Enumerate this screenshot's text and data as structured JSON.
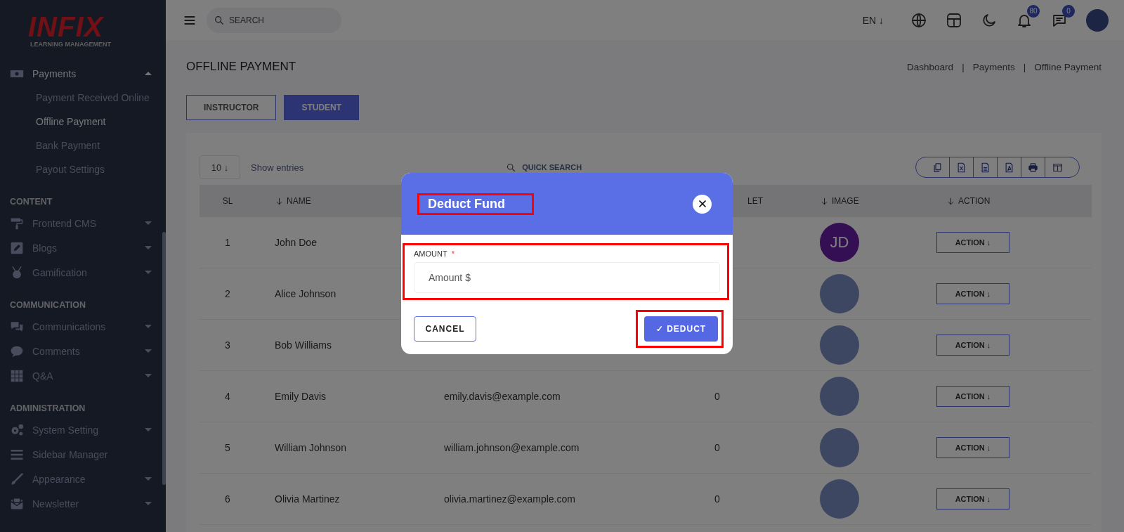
{
  "sidebar": {
    "logo": {
      "mark": "INFIX",
      "tagline": "LEARNING MANAGEMENT"
    },
    "sections": [
      {
        "items": [
          {
            "label": "Payments",
            "expandable": true,
            "expanded": true,
            "children": [
              {
                "label": "Payment Received Online",
                "selected": false
              },
              {
                "label": "Offline Payment",
                "selected": true
              },
              {
                "label": "Bank Payment",
                "selected": false
              },
              {
                "label": "Payout Settings",
                "selected": false
              }
            ]
          }
        ]
      },
      {
        "heading": "CONTENT",
        "items": [
          {
            "label": "Frontend CMS",
            "expandable": true,
            "expanded": false
          },
          {
            "label": "Blogs",
            "expandable": true,
            "expanded": false
          },
          {
            "label": "Gamification",
            "expandable": true,
            "expanded": false
          }
        ]
      },
      {
        "heading": "COMMUNICATION",
        "items": [
          {
            "label": "Communications",
            "expandable": true,
            "expanded": false
          },
          {
            "label": "Comments",
            "expandable": true,
            "expanded": false
          },
          {
            "label": "Q&A",
            "expandable": true,
            "expanded": false
          }
        ]
      },
      {
        "heading": "ADMINISTRATION",
        "items": [
          {
            "label": "System Setting",
            "expandable": true,
            "expanded": false
          },
          {
            "label": "Sidebar Manager",
            "expandable": false,
            "expanded": false
          },
          {
            "label": "Appearance",
            "expandable": true,
            "expanded": false
          },
          {
            "label": "Newsletter",
            "expandable": true,
            "expanded": false
          }
        ]
      }
    ]
  },
  "topbar": {
    "search": {
      "placeholder": "SEARCH"
    },
    "language": "EN ↓",
    "notifications": "80",
    "messages": "0"
  },
  "page": {
    "title": "OFFLINE PAYMENT",
    "breadcrumb": [
      "Dashboard",
      "Payments",
      "Offline Payment"
    ],
    "breadcrumb_separator": "|",
    "tabs": [
      {
        "label": "INSTRUCTOR",
        "selected": false
      },
      {
        "label": "STUDENT",
        "selected": true
      }
    ]
  },
  "table": {
    "page_size": "10 ↓",
    "show_entries": "Show entries",
    "quick_search": "QUICK SEARCH",
    "columns": [
      {
        "label": "SL",
        "sortable": false
      },
      {
        "label": "NAME",
        "sortable": true
      },
      {
        "label": "LET",
        "sortable": false
      },
      {
        "label": "IMAGE",
        "sortable": true
      },
      {
        "label": "ACTION",
        "sortable": true
      }
    ],
    "rows": [
      {
        "sl": "1",
        "name": "John Doe",
        "avatar": {
          "kind": "initials",
          "initials": "JD"
        },
        "action": "ACTION ↓"
      },
      {
        "sl": "2",
        "name": "Alice Johnson",
        "avatar": {
          "kind": "photo"
        },
        "action": "ACTION ↓"
      },
      {
        "sl": "3",
        "name": "Bob Williams",
        "avatar": {
          "kind": "photo"
        },
        "action": "ACTION ↓"
      },
      {
        "sl": "4",
        "name": "Emily Davis",
        "email": "emily.davis@example.com",
        "wallet": "0",
        "avatar": {
          "kind": "photo"
        },
        "action": "ACTION ↓"
      },
      {
        "sl": "5",
        "name": "William Johnson",
        "email": "william.johnson@example.com",
        "wallet": "0",
        "avatar": {
          "kind": "photo"
        },
        "action": "ACTION ↓"
      },
      {
        "sl": "6",
        "name": "Olivia Martinez",
        "email": "olivia.martinez@example.com",
        "wallet": "0",
        "avatar": {
          "kind": "photo"
        },
        "action": "ACTION ↓"
      }
    ]
  },
  "modal": {
    "title": "Deduct Fund",
    "title_highlighted": true,
    "field": {
      "label": "AMOUNT",
      "required": true,
      "required_mark": "*",
      "placeholder": "Amount $",
      "highlighted": true
    },
    "cancel": "CANCEL",
    "submit": {
      "label": "✓ DEDUCT",
      "highlighted": true
    }
  }
}
